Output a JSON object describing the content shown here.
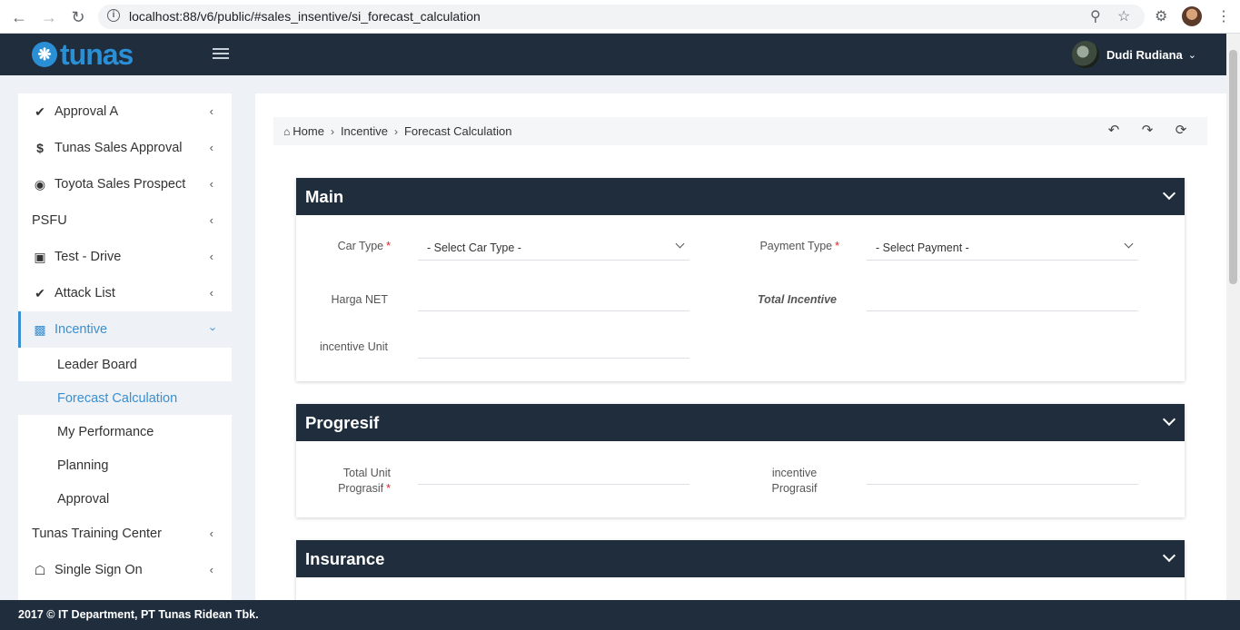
{
  "browser": {
    "url": "localhost:88/v6/public/#sales_insentive/si_forecast_calculation"
  },
  "header": {
    "logo_text": "tunas",
    "user_name": "Dudi Rudiana"
  },
  "sidebar": {
    "items": [
      {
        "label": "Approval A",
        "icon": "check-icon"
      },
      {
        "label": "Tunas Sales Approval",
        "icon": "dollar-icon"
      },
      {
        "label": "Toyota Sales Prospect",
        "icon": "dashboard-icon"
      },
      {
        "label": "PSFU",
        "icon": ""
      },
      {
        "label": "Test - Drive",
        "icon": "car-icon"
      },
      {
        "label": "Attack List",
        "icon": "check-icon"
      },
      {
        "label": "Incentive",
        "icon": "briefcase-icon",
        "active": true
      }
    ],
    "sub_items": [
      {
        "label": "Leader Board"
      },
      {
        "label": "Forecast Calculation",
        "selected": true
      },
      {
        "label": "My Performance"
      },
      {
        "label": "Planning"
      },
      {
        "label": "Approval"
      }
    ],
    "bottom_items": [
      {
        "label": "Tunas Training Center",
        "icon": ""
      },
      {
        "label": "Single Sign On",
        "icon": "lock-icon"
      }
    ]
  },
  "breadcrumb": {
    "home": "Home",
    "level1": "Incentive",
    "level2": "Forecast Calculation"
  },
  "main_panel": {
    "title": "Main",
    "car_type_label": "Car Type",
    "car_type_value": "- Select Car Type -",
    "payment_type_label": "Payment Type",
    "payment_type_value": "- Select Payment -",
    "harga_net_label": "Harga NET",
    "total_incentive_label": "Total Incentive",
    "incentive_unit_label": "incentive Unit",
    "required_mark": "*"
  },
  "progresif_panel": {
    "title": "Progresif",
    "total_unit_label_line1": "Total Unit",
    "total_unit_label_line2": "Prograsif",
    "incentive_label_line1": "incentive",
    "incentive_label_line2": "Prograsif",
    "required_mark": "*"
  },
  "insurance_panel": {
    "title": "Insurance"
  },
  "footer": {
    "text": "2017 © IT Department, PT Tunas Ridean Tbk."
  }
}
